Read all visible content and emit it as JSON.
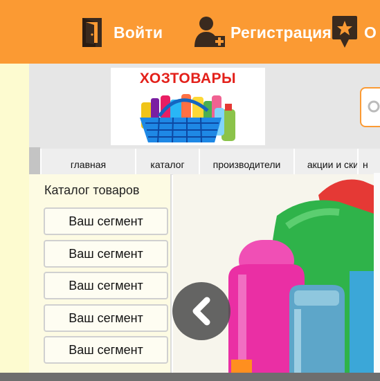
{
  "topbar": {
    "login_label": "Войти",
    "register_label": "Регистрация",
    "third_label_partial": "О",
    "icons": [
      "door-icon",
      "user-plus-icon",
      "star-pin-icon"
    ]
  },
  "banner": {
    "title": "ХОЗТОВАРЫ"
  },
  "nav": {
    "tabs": [
      {
        "label": "главная"
      },
      {
        "label": "каталог"
      },
      {
        "label": "производители"
      },
      {
        "label": "акции и скидки"
      },
      {
        "label": "н"
      }
    ]
  },
  "catalog": {
    "title": "Каталог товаров",
    "items": [
      {
        "label": "Ваш сегмент"
      },
      {
        "label": "Ваш сегмент"
      },
      {
        "label": "Ваш сегмент"
      },
      {
        "label": "Ваш сегмент"
      },
      {
        "label": "Ваш сегмент"
      }
    ]
  },
  "colors": {
    "accent": "#fb9a33",
    "banner_title": "#e3201a",
    "sidebar_bg": "#fdfbd0",
    "panel_gray": "#e6e6e6"
  }
}
